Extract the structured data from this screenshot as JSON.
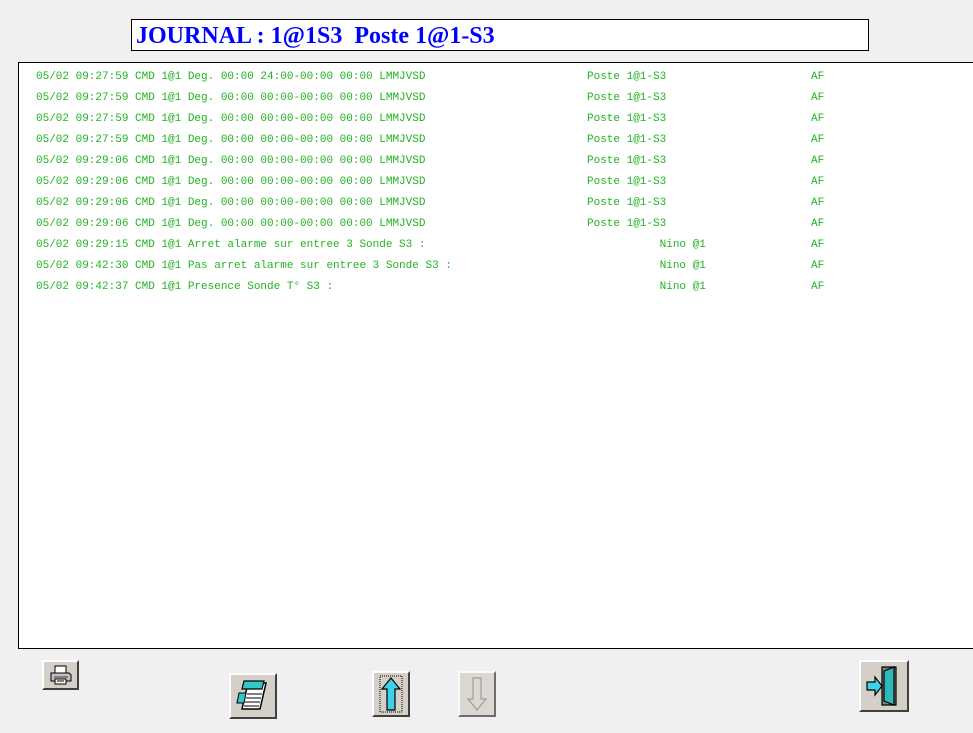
{
  "title": "JOURNAL : 1@1S3  Poste 1@1-S3",
  "colors": {
    "title_text": "#0000ff",
    "log_text": "#22b322",
    "log_background": "#ffffff",
    "window_background": "#f0f0f0"
  },
  "log": {
    "rows": [
      {
        "message": "05/02 09:27:59 CMD 1@1 Deg. 00:00 24:00-00:00 00:00 LMMJVSD",
        "source": "Poste 1@1-S3",
        "code": "AF"
      },
      {
        "message": "05/02 09:27:59 CMD 1@1 Deg. 00:00 00:00-00:00 00:00 LMMJVSD",
        "source": "Poste 1@1-S3",
        "code": "AF"
      },
      {
        "message": "05/02 09:27:59 CMD 1@1 Deg. 00:00 00:00-00:00 00:00 LMMJVSD",
        "source": "Poste 1@1-S3",
        "code": "AF"
      },
      {
        "message": "05/02 09:27:59 CMD 1@1 Deg. 00:00 00:00-00:00 00:00 LMMJVSD",
        "source": "Poste 1@1-S3",
        "code": "AF"
      },
      {
        "message": "05/02 09:29:06 CMD 1@1 Deg. 00:00 00:00-00:00 00:00 LMMJVSD",
        "source": "Poste 1@1-S3",
        "code": "AF"
      },
      {
        "message": "05/02 09:29:06 CMD 1@1 Deg. 00:00 00:00-00:00 00:00 LMMJVSD",
        "source": "Poste 1@1-S3",
        "code": "AF"
      },
      {
        "message": "05/02 09:29:06 CMD 1@1 Deg. 00:00 00:00-00:00 00:00 LMMJVSD",
        "source": "Poste 1@1-S3",
        "code": "AF"
      },
      {
        "message": "05/02 09:29:06 CMD 1@1 Deg. 00:00 00:00-00:00 00:00 LMMJVSD",
        "source": "Poste 1@1-S3",
        "code": "AF"
      },
      {
        "message": "05/02 09:29:15 CMD 1@1 Arret alarme sur entree 3 Sonde S3 :",
        "source": "           Nino @1",
        "code": "AF"
      },
      {
        "message": "05/02 09:42:30 CMD 1@1 Pas arret alarme sur entree 3 Sonde S3 :",
        "source": "           Nino @1",
        "code": "AF"
      },
      {
        "message": "05/02 09:42:37 CMD 1@1 Presence Sonde T° S3 :",
        "source": "           Nino @1",
        "code": "AF"
      }
    ]
  },
  "toolbar": {
    "print_icon": "printer-icon",
    "notes_icon": "notepad-icon",
    "up_icon": "arrow-up-icon",
    "down_icon": "arrow-down-icon",
    "exit_icon": "exit-door-icon",
    "down_enabled": false
  }
}
